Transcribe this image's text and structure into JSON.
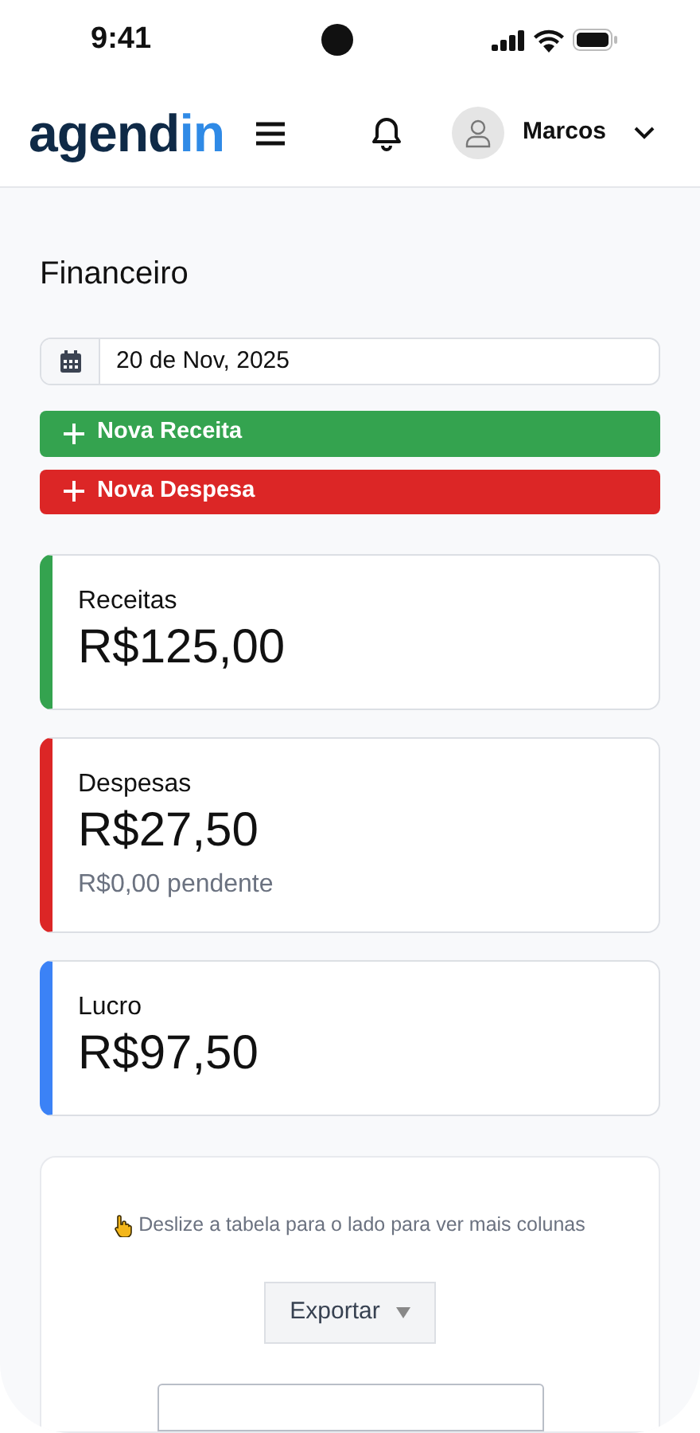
{
  "status_bar": {
    "time": "9:41"
  },
  "header": {
    "logo": {
      "part_1": "agend",
      "part_2": "in"
    },
    "user": {
      "name": "Marcos"
    }
  },
  "page": {
    "title": "Financeiro"
  },
  "date_field": {
    "value": "20 de Nov, 2025"
  },
  "actions": [
    {
      "label": "Nova Receita",
      "color": "#34a34f"
    },
    {
      "label": "Nova Despesa",
      "color": "#dc2626"
    }
  ],
  "summary": [
    {
      "label": "Receitas",
      "amount": "R$125,00",
      "color": "#34a34f"
    },
    {
      "label": "Despesas",
      "amount": "R$27,50",
      "note": "R$0,00 pendente",
      "color": "#dc2626"
    },
    {
      "label": "Lucro",
      "amount": "R$97,50",
      "color": "#3b82f6"
    }
  ],
  "table_panel": {
    "hint": "Deslize a tabela para o lado para ver mais colunas",
    "export_button": "Exportar"
  }
}
